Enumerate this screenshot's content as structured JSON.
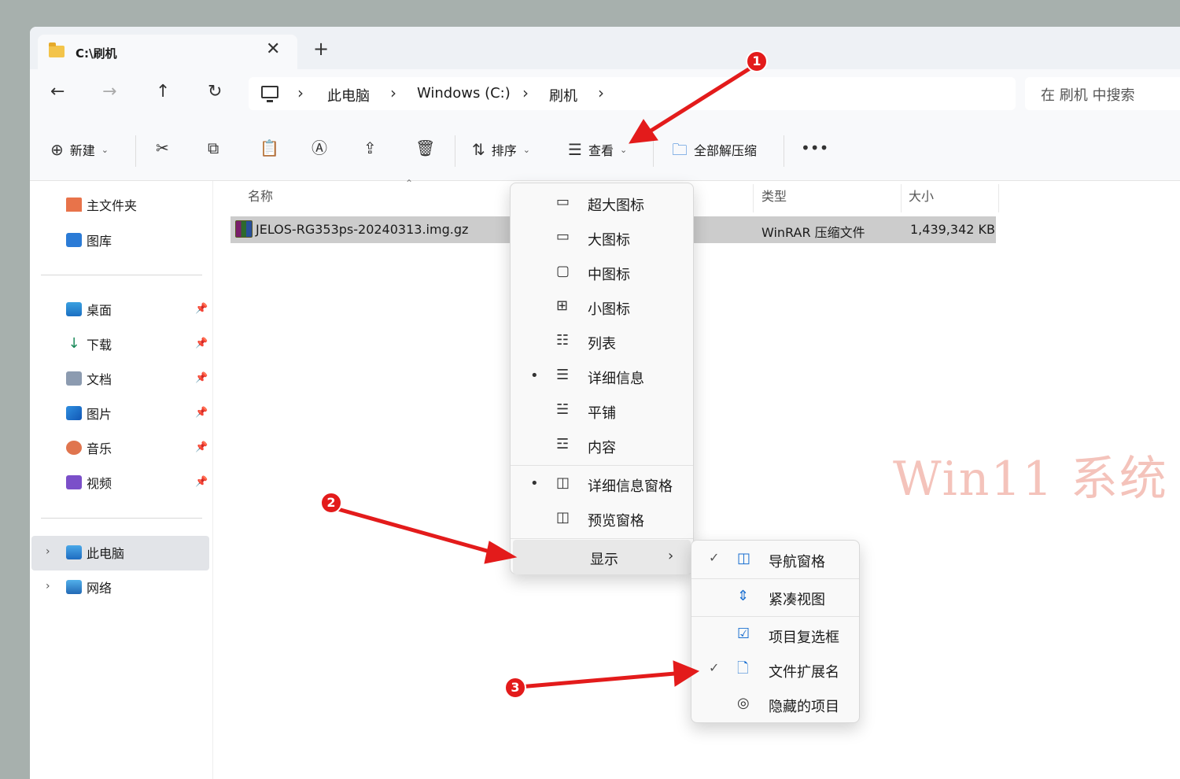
{
  "window": {
    "tab_title": "C:\\刷机",
    "tab_close": "✕",
    "new_tab": "+"
  },
  "nav": {
    "back": "←",
    "forward": "→",
    "up": "↑",
    "refresh": "↻",
    "breadcrumbs": [
      "此电脑",
      "Windows (C:)",
      "刷机"
    ],
    "separator": "›",
    "search_placeholder": "在 刷机 中搜索"
  },
  "toolbar": {
    "new_label": "新建",
    "sort_label": "排序",
    "view_label": "查看",
    "extract_all_label": "全部解压缩",
    "more": "•••"
  },
  "sidebar": {
    "home": "主文件夹",
    "gallery": "图库",
    "pinned": [
      "桌面",
      "下载",
      "文档",
      "图片",
      "音乐",
      "视频"
    ],
    "this_pc": "此电脑",
    "network": "网络"
  },
  "columns": {
    "name": "名称",
    "type": "类型",
    "size": "大小"
  },
  "files": [
    {
      "name": "JELOS-RG353ps-20240313.img.gz",
      "type": "WinRAR 压缩文件",
      "size": "1,439,342 KB"
    }
  ],
  "view_menu": {
    "items": [
      "超大图标",
      "大图标",
      "中图标",
      "小图标",
      "列表",
      "详细信息",
      "平铺",
      "内容"
    ],
    "panes": [
      "详细信息窗格",
      "预览窗格"
    ],
    "show": "显示",
    "selected_dot": "•"
  },
  "show_submenu": {
    "items": [
      "导航窗格",
      "紧凑视图",
      "项目复选框",
      "文件扩展名",
      "隐藏的项目"
    ],
    "check": "✓"
  },
  "annotations": {
    "badges": [
      "1",
      "2",
      "3"
    ],
    "color": "#e31b1b"
  },
  "watermark": "Win11 系统"
}
